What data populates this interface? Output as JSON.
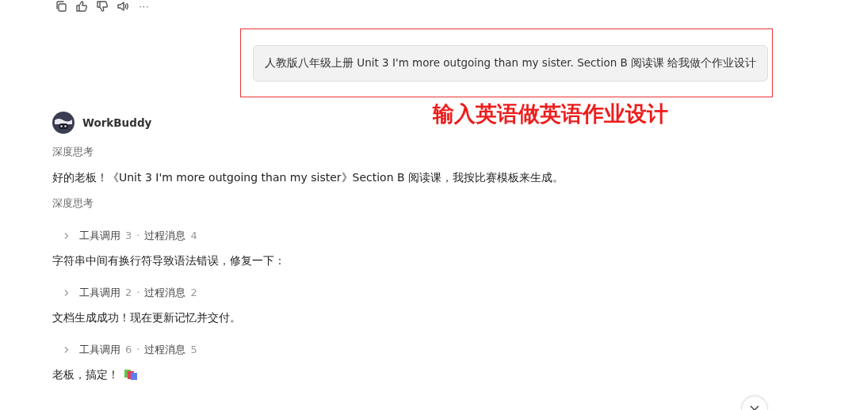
{
  "message_actions": {
    "more": "···"
  },
  "user_message": {
    "text": "人教版八年级上册 Unit 3 I'm more outgoing than my sister. Section B 阅读课 给我做个作业设计",
    "annotation": "输入英语做英语作业设计"
  },
  "assistant": {
    "name": "WorkBuddy"
  },
  "steps": [
    {
      "kind": "thinking",
      "text": "深度思考"
    },
    {
      "kind": "text",
      "text": "好的老板！《Unit 3 I'm more outgoing than my sister》Section B 阅读课，我按比赛模板来生成。"
    },
    {
      "kind": "thinking",
      "text": "深度思考"
    },
    {
      "kind": "tools",
      "expanded": false,
      "tool_label": "工具调用",
      "tool_count": "3",
      "separator": "·",
      "message_label": "过程消息",
      "message_count": "4"
    },
    {
      "kind": "text",
      "text": "字符串中间有换行符导致语法错误，修复一下："
    },
    {
      "kind": "tools",
      "expanded": false,
      "tool_label": "工具调用",
      "tool_count": "2",
      "separator": "·",
      "message_label": "过程消息",
      "message_count": "2"
    },
    {
      "kind": "text",
      "text": "文档生成成功！现在更新记忆并交付。"
    },
    {
      "kind": "tools",
      "expanded": false,
      "tool_label": "工具调用",
      "tool_count": "6",
      "separator": "·",
      "message_label": "过程消息",
      "message_count": "5"
    },
    {
      "kind": "text",
      "text": "老板，搞定！",
      "emoji": true
    }
  ]
}
